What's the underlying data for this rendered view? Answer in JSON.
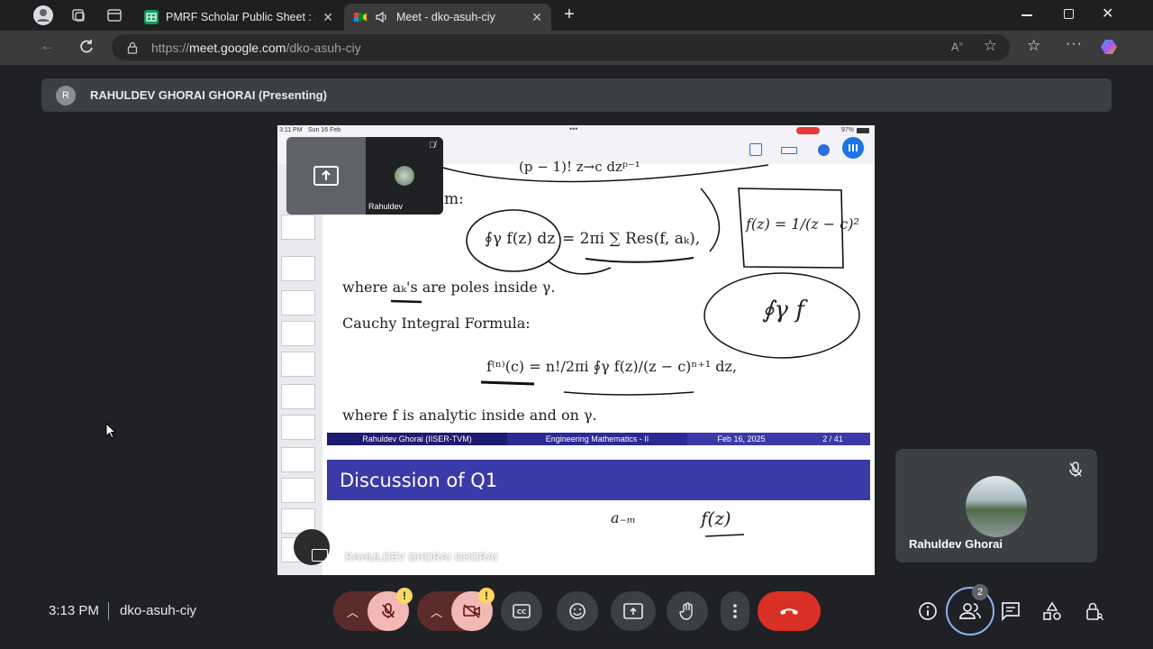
{
  "browser": {
    "tabs": [
      {
        "title": "PMRF Scholar Public Sheet : Janua",
        "active": false
      },
      {
        "title": "Meet - dko-asuh-ciy",
        "active": true
      }
    ],
    "url_prefix": "https://",
    "url_domain": "meet.google.com",
    "url_path": "/dko-asuh-ciy"
  },
  "banner": {
    "avatar_letter": "R",
    "text": "RAHULDEV GHORAI GHORAI (Presenting)"
  },
  "ipad": {
    "time": "3:11 PM",
    "date": "Sun 16 Feb",
    "battery": "97%"
  },
  "slide": {
    "theorem_end": "m:",
    "residue_rhs": "= 2πi ∑ Res(f, aₖ),",
    "residue_lhs": "∮γ f(z) dz",
    "where1": "where aₖ's are poles inside γ.",
    "cif_title": "Cauchy Integral Formula:",
    "cif_formula": "f⁽ⁿ⁾(c) = n!/2πi ∮γ f(z)/(z − c)ⁿ⁺¹ dz,",
    "where2": "where f is analytic inside and on γ.",
    "footer_author": "Rahuldev Ghorai  (IISER-TVM)",
    "footer_course": "Engineering Mathematics - II",
    "footer_date": "Feb 16, 2025",
    "footer_page": "2 / 41",
    "next_title": "Discussion of Q1",
    "handwriting_top": "(p − 1)! z→c dzᵖ⁻¹",
    "handwriting_note": "f(z) = 1/(z − c)²",
    "handwriting_circle": "∮γ f",
    "handwriting_a": "a₋ₘ",
    "handwriting_fz": "f(z)"
  },
  "self_tile": {
    "name": "Rahuldev"
  },
  "presenter_overlay": "RAHULDEV GHORAI GHORAI",
  "participant": {
    "name": "Rahuldev Ghorai"
  },
  "bottom": {
    "time": "3:13 PM",
    "meeting_code": "dko-asuh-ciy",
    "people_count": "2",
    "warn_mark": "!"
  }
}
